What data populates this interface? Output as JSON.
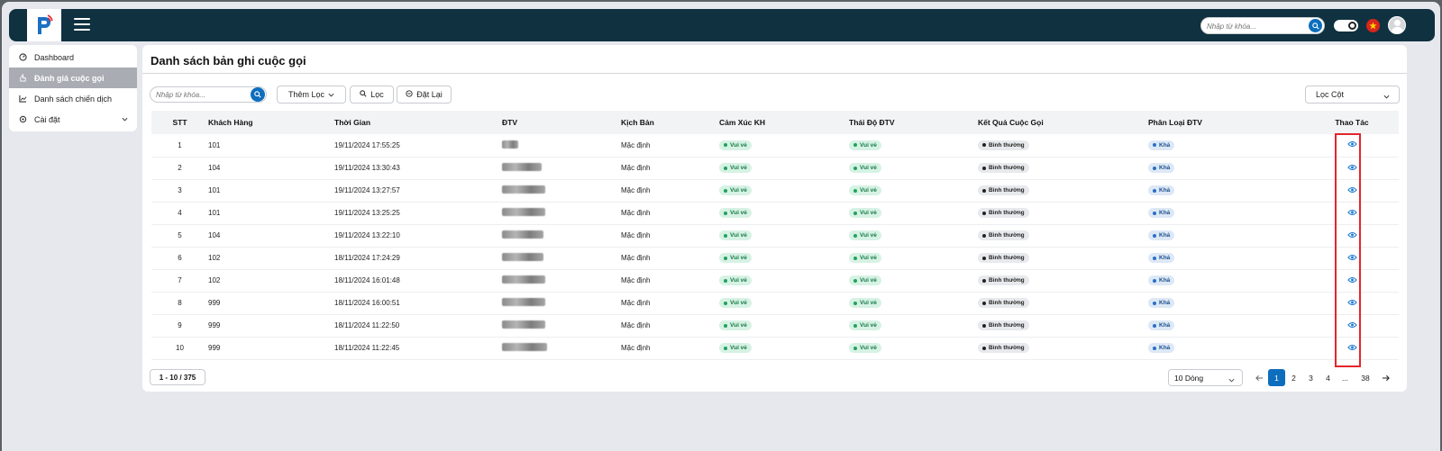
{
  "search": {
    "placeholder": "Nhập từ khóa..."
  },
  "sidebar": {
    "items": [
      {
        "label": "Dashboard"
      },
      {
        "label": "Đánh giá cuộc gọi"
      },
      {
        "label": "Danh sách chiến dịch"
      },
      {
        "label": "Cài đặt"
      }
    ]
  },
  "page": {
    "title": "Danh sách bản ghi cuộc gọi",
    "search_placeholder": "Nhập từ khóa...",
    "add_filter": "Thêm Lọc",
    "filter": "Lọc",
    "reset": "Đặt Lại",
    "column_filter": "Lọc Cột"
  },
  "table": {
    "headers": [
      "STT",
      "Khách Hàng",
      "Thời Gian",
      "ĐTV",
      "Kịch Bản",
      "Cảm Xúc KH",
      "Thái Độ ĐTV",
      "Kết Quả Cuộc Gọi",
      "Phân Loại ĐTV",
      "Thao Tác"
    ],
    "rows": [
      {
        "stt": "1",
        "customer": "101",
        "time": "19/11/2024 17:55:25",
        "script": "Mặc định",
        "emotion": "Vui vẻ",
        "attitude": "Vui vẻ",
        "result": "Bình thường",
        "category": "Khá"
      },
      {
        "stt": "2",
        "customer": "104",
        "time": "19/11/2024 13:30:43",
        "script": "Mặc định",
        "emotion": "Vui vẻ",
        "attitude": "Vui vẻ",
        "result": "Bình thường",
        "category": "Khá"
      },
      {
        "stt": "3",
        "customer": "101",
        "time": "19/11/2024 13:27:57",
        "script": "Mặc định",
        "emotion": "Vui vẻ",
        "attitude": "Vui vẻ",
        "result": "Bình thường",
        "category": "Khá"
      },
      {
        "stt": "4",
        "customer": "101",
        "time": "19/11/2024 13:25:25",
        "script": "Mặc định",
        "emotion": "Vui vẻ",
        "attitude": "Vui vẻ",
        "result": "Bình thường",
        "category": "Khá"
      },
      {
        "stt": "5",
        "customer": "104",
        "time": "19/11/2024 13:22:10",
        "script": "Mặc định",
        "emotion": "Vui vẻ",
        "attitude": "Vui vẻ",
        "result": "Bình thường",
        "category": "Khá"
      },
      {
        "stt": "6",
        "customer": "102",
        "time": "18/11/2024 17:24:29",
        "script": "Mặc định",
        "emotion": "Vui vẻ",
        "attitude": "Vui vẻ",
        "result": "Bình thường",
        "category": "Khá"
      },
      {
        "stt": "7",
        "customer": "102",
        "time": "18/11/2024 16:01:48",
        "script": "Mặc định",
        "emotion": "Vui vẻ",
        "attitude": "Vui vẻ",
        "result": "Bình thường",
        "category": "Khá"
      },
      {
        "stt": "8",
        "customer": "999",
        "time": "18/11/2024 16:00:51",
        "script": "Mặc định",
        "emotion": "Vui vẻ",
        "attitude": "Vui vẻ",
        "result": "Bình thường",
        "category": "Khá"
      },
      {
        "stt": "9",
        "customer": "999",
        "time": "18/11/2024 11:22:50",
        "script": "Mặc định",
        "emotion": "Vui vẻ",
        "attitude": "Vui vẻ",
        "result": "Bình thường",
        "category": "Khá"
      },
      {
        "stt": "10",
        "customer": "999",
        "time": "18/11/2024 11:22:45",
        "script": "Mặc định",
        "emotion": "Vui vẻ",
        "attitude": "Vui vẻ",
        "result": "Bình thường",
        "category": "Khá"
      }
    ]
  },
  "footer": {
    "range": "1 - 10 / 375",
    "rows_per_page": "10 Dòng",
    "pages": [
      "1",
      "2",
      "3",
      "4",
      "...",
      "38"
    ]
  },
  "colors": {
    "topbar": "#0f3140",
    "accent": "#0d6ebd",
    "highlight": "#e3262b"
  },
  "icons": [
    "logo-icon",
    "menu-icon",
    "search-icon",
    "theme-toggle-icon",
    "flag-vn-icon",
    "avatar-icon",
    "dashboard-icon",
    "review-icon",
    "campaign-icon",
    "settings-icon",
    "eye-icon",
    "arrow-left-icon",
    "arrow-right-icon"
  ]
}
